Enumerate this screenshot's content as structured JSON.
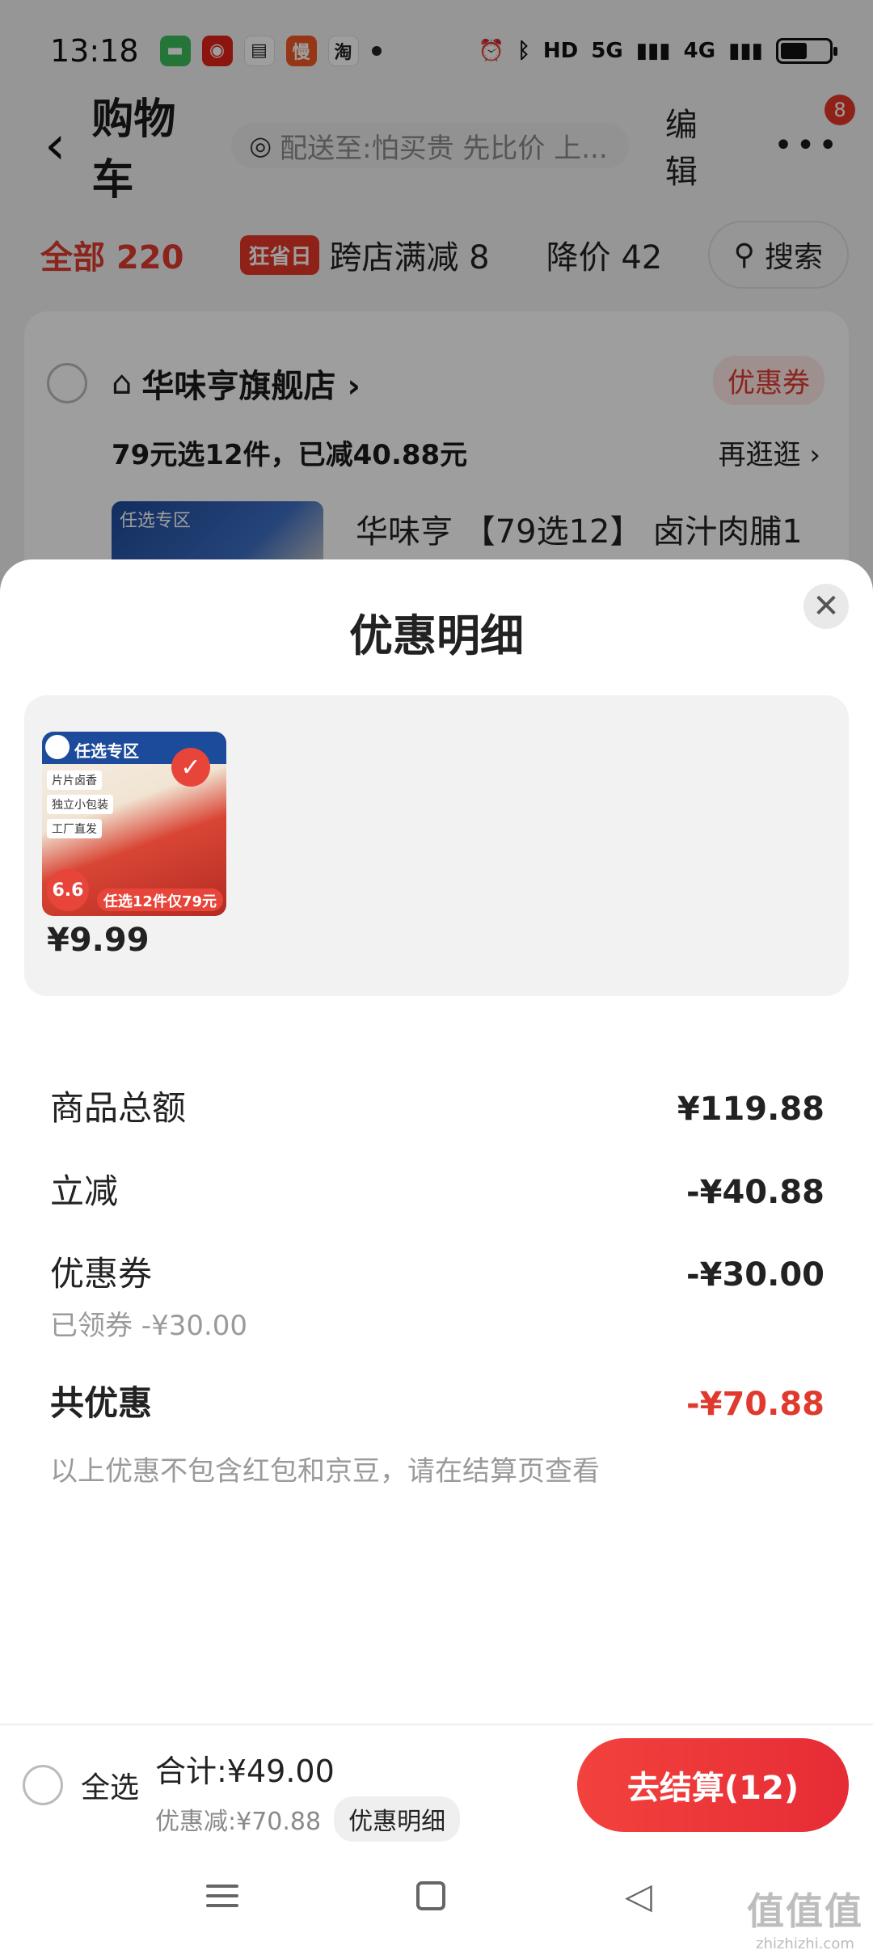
{
  "status_bar": {
    "time": "13:18",
    "notifications": [
      {
        "icon": "message-icon",
        "color": "#3cbd5c",
        "glyph": "▬"
      },
      {
        "icon": "jd-icon",
        "color": "#e2231a",
        "glyph": "◉"
      },
      {
        "icon": "wallet-icon",
        "color": "#ffffff",
        "glyph": "▤"
      },
      {
        "icon": "slow-icon",
        "color": "#f15a24",
        "glyph": "慢"
      },
      {
        "icon": "taobao-icon",
        "color": "#ffffff",
        "glyph": "淘"
      }
    ],
    "hd_label": "HD",
    "net_5g": "5G",
    "net_4g": "4G"
  },
  "header": {
    "title": "购物车",
    "address": "配送至:怕买贵 先比价 上...",
    "edit_label": "编辑",
    "more_label": "•••",
    "badge_count": "8"
  },
  "filters": {
    "all_label": "全部 220",
    "cross_badge": "狂省日",
    "cross_label": "跨店满减 8",
    "price_drop_label": "降价 42",
    "search_label": "搜索"
  },
  "store": {
    "name": "华味亨旗舰店 ›",
    "coupon_label": "优惠券",
    "promo_text": "79元选12件，已减40.88元",
    "promo_link": "再逛逛 ›",
    "thumb_label": "任选专区",
    "product_title": "华味亨 【79选12】 卤汁肉脯1"
  },
  "sheet": {
    "title": "优惠明细",
    "close_label": "✕",
    "item": {
      "banner": "任选专区",
      "tags": [
        "片片卤香",
        "独立小包装",
        "工厂直发"
      ],
      "badge_price": "6.6",
      "strip": "任选12件仅79元",
      "price": "¥9.99"
    },
    "rows": {
      "goods_total_label": "商品总额",
      "goods_total_value": "¥119.88",
      "instant_cut_label": "立减",
      "instant_cut_value": "-¥40.88",
      "coupon_label": "优惠券",
      "coupon_value": "-¥30.00",
      "coupon_sub": "已领券 -¥30.00",
      "total_discount_label": "共优惠",
      "total_discount_value": "-¥70.88",
      "note": "以上优惠不包含红包和京豆，请在结算页查看"
    }
  },
  "checkout": {
    "select_all_label": "全选",
    "total_text": "合计:¥49.00",
    "discount_text": "优惠减:¥70.88",
    "detail_chip": "优惠明细",
    "checkout_label": "去结算(12)"
  },
  "nav": {
    "back_glyph": "◁"
  },
  "watermark": {
    "big": "值值值",
    "small": "zhizhizhi.com"
  },
  "colors": {
    "accent_red": "#e03a2f",
    "checkout_red": "#e62c35"
  }
}
